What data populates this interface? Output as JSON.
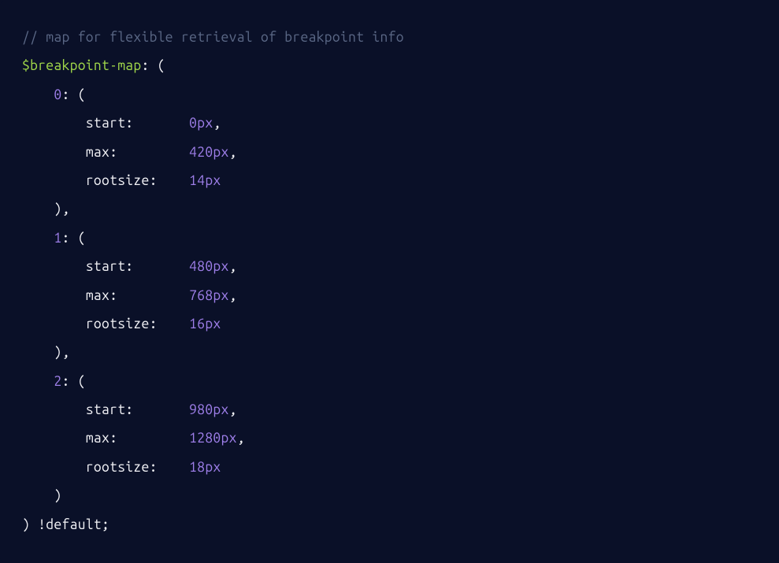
{
  "code": {
    "comment": "// map for flexible retrieval of breakpoint info",
    "variable": "$breakpoint-map",
    "colon_open": ": (",
    "entries": [
      {
        "key": "0",
        "open": ": (",
        "props": {
          "start_label": "start:",
          "start_value": "0px",
          "max_label": "max:",
          "max_value": "420px",
          "rootsize_label": "rootsize:",
          "rootsize_value": "14px"
        },
        "close": "),"
      },
      {
        "key": "1",
        "open": ": (",
        "props": {
          "start_label": "start:",
          "start_value": "480px",
          "max_label": "max:",
          "max_value": "768px",
          "rootsize_label": "rootsize:",
          "rootsize_value": "16px"
        },
        "close": "),"
      },
      {
        "key": "2",
        "open": ": (",
        "props": {
          "start_label": "start:",
          "start_value": "980px",
          "max_label": "max:",
          "max_value": "1280px",
          "rootsize_label": "rootsize:",
          "rootsize_value": "18px"
        },
        "close": ")"
      }
    ],
    "close": ") !default;",
    "comma": ","
  }
}
